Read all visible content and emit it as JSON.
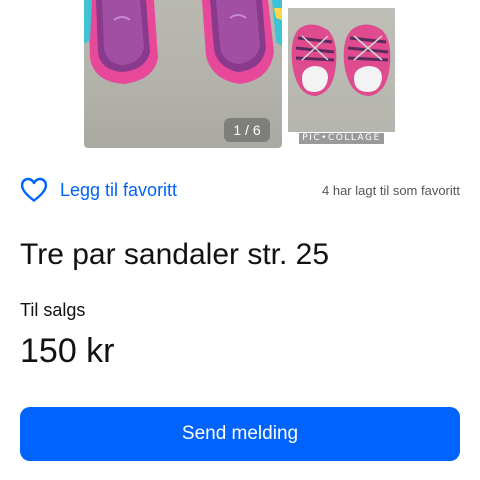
{
  "gallery": {
    "counter": "1 / 6",
    "collage_label": "PIC•COLLAGE"
  },
  "favorite": {
    "link_label": "Legg til favoritt",
    "count_text": "4 har lagt til som favoritt",
    "icon": "heart-outline-icon",
    "accent_color": "#0063fb"
  },
  "listing": {
    "title": "Tre par sandaler str. 25",
    "status": "Til salgs",
    "price": "150 kr"
  },
  "actions": {
    "send_label": "Send melding",
    "button_color": "#0063fb"
  }
}
